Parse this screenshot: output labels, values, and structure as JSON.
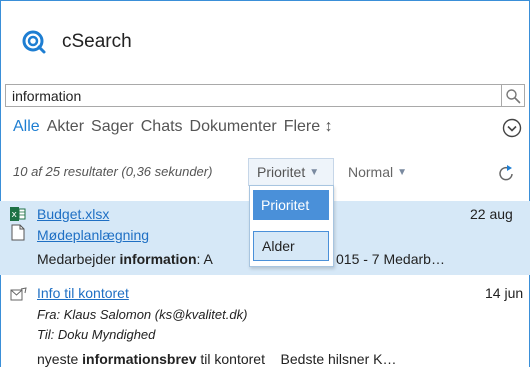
{
  "app": {
    "title": "cSearch"
  },
  "search": {
    "value": "information",
    "placeholder": ""
  },
  "filters": {
    "items": [
      "Alle",
      "Akter",
      "Sager",
      "Chats",
      "Dokumenter"
    ],
    "more_label": "Flere ↕"
  },
  "status": {
    "results_text": "10 af 25 resultater (0,36 sekunder)"
  },
  "sort": {
    "selected": "Prioritet",
    "secondary": "Normal",
    "options": [
      "Prioritet",
      "Alder"
    ]
  },
  "results": [
    {
      "title": "Budget.xlsx",
      "subtitle": "Mødeplanlægning",
      "date": "22 aug",
      "snippet_pre": "Medarbejder ",
      "snippet_bold": "information",
      "snippet_post": ": A",
      "snippet_tail": "015 - 7 Medarb…",
      "icons": [
        "excel-icon",
        "document-icon"
      ]
    },
    {
      "title": "Info til kontoret",
      "date": "14 jun",
      "from": "Fra: Klaus Salomon (ks@kvalitet.dk)",
      "to": "Til: Doku Myndighed",
      "snippet_pre": "nyeste ",
      "snippet_bold": "informationsbrev",
      "snippet_post": " til kontoret    Bedste hilsner K…",
      "icons": [
        "email-icon"
      ]
    }
  ],
  "colors": {
    "accent": "#1e7ed2",
    "selection": "#d6e8f7",
    "dropdown_selected": "#4a90d9"
  }
}
